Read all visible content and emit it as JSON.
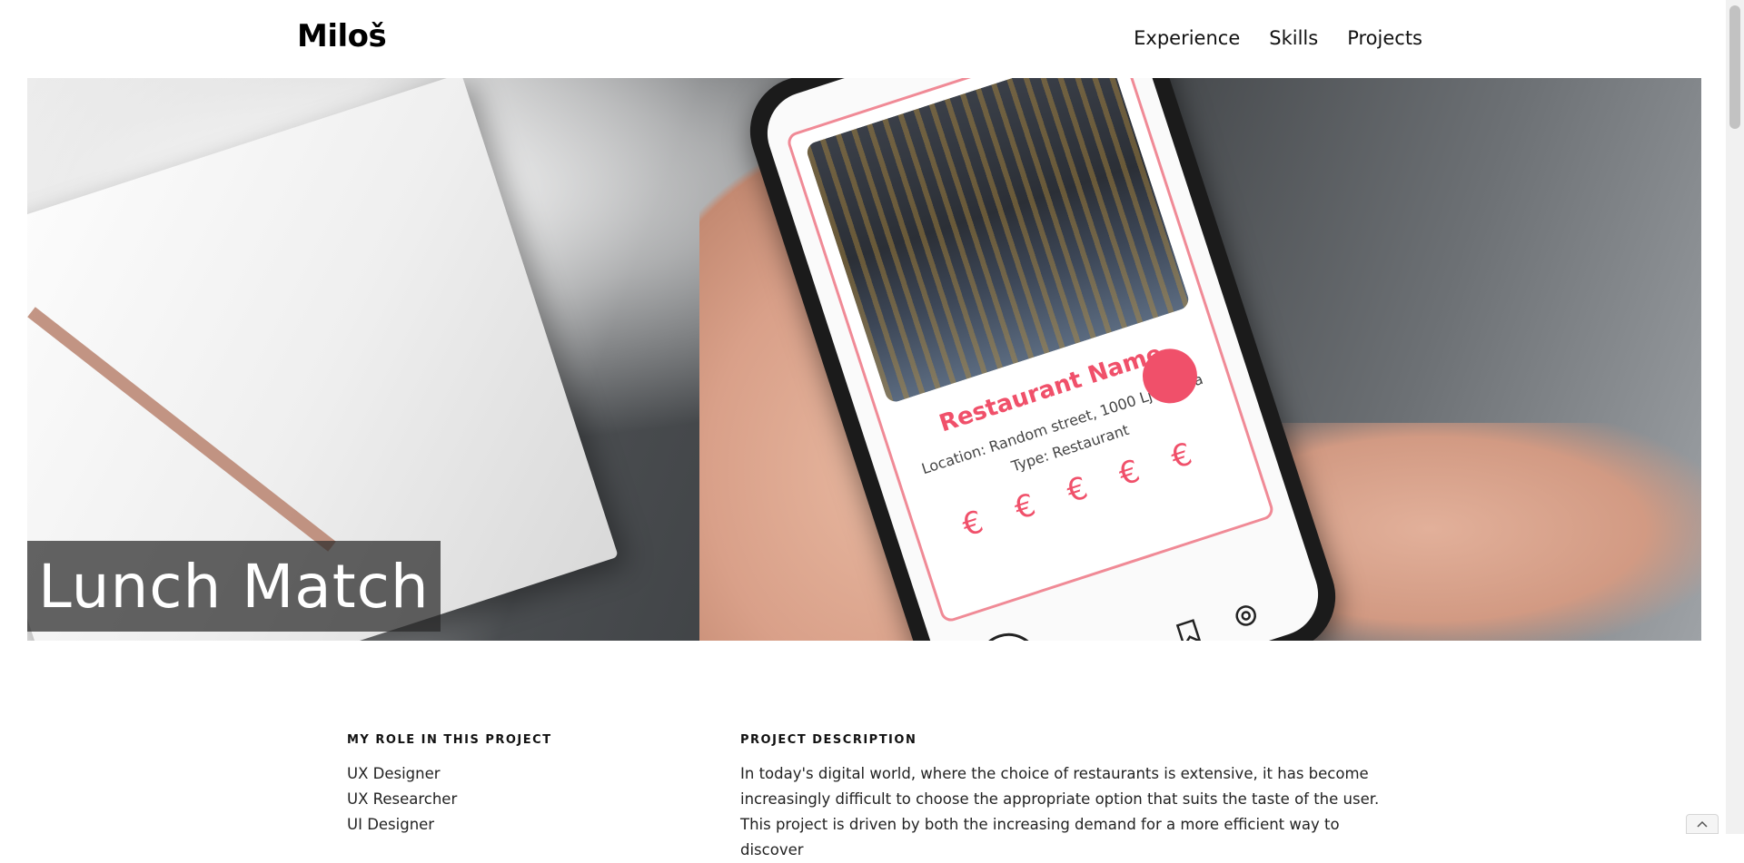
{
  "header": {
    "logo": "Miloš",
    "nav": [
      {
        "label": "Experience"
      },
      {
        "label": "Skills"
      },
      {
        "label": "Projects"
      }
    ]
  },
  "hero": {
    "title": "Lunch Match",
    "phone_card": {
      "restaurant_name": "Restaurant Name",
      "location": "Location: Random street, 1000 Ljubljana",
      "type": "Type: Restaurant",
      "price": "€ € € € €"
    }
  },
  "content": {
    "role_heading": "MY ROLE IN THIS PROJECT",
    "roles": [
      "UX Designer",
      "UX Researcher",
      "UI Designer"
    ],
    "description_heading": "PROJECT DESCRIPTION",
    "description": "In today's digital world, where the choice of restaurants is extensive, it has become increasingly difficult to choose the appropriate option that suits the taste of the user. This project is driven by both the increasing demand for a more efficient way to discover"
  },
  "colors": {
    "accent": "#f0506a",
    "text": "#111111",
    "title_overlay": "#282828"
  },
  "icons": [
    "close-icon",
    "bookmark-icon",
    "settings-icon",
    "chevron-up-icon"
  ]
}
